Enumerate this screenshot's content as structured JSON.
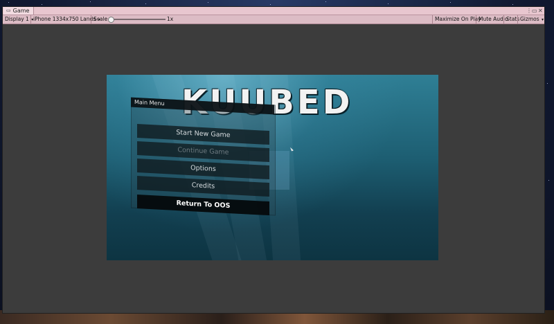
{
  "window": {
    "tab_label": "Game",
    "tab_icon": "gamepad-icon",
    "controls": [
      "⋮",
      "▭",
      "✕"
    ]
  },
  "toolbar": {
    "display": "Display 1",
    "resolution": "iPhone 1334x750 Lands",
    "scale_label": "Scale",
    "scale_value": "1x",
    "maximize": "Maximize On Play",
    "mute": "Mute Audio",
    "stats": "Stats",
    "gizmos": "Gizmos"
  },
  "game": {
    "logo": "KUUBED",
    "menu": {
      "title": "Main Menu",
      "items": [
        {
          "label": "Start New Game",
          "state": "normal"
        },
        {
          "label": "Continue Game",
          "state": "disabled"
        },
        {
          "label": "Options",
          "state": "normal"
        },
        {
          "label": "Credits",
          "state": "normal"
        },
        {
          "label": "Return To OOS",
          "state": "selected"
        }
      ]
    }
  },
  "colors": {
    "titlebar": "#e8c6cf",
    "toolbar": "#dcbcc5",
    "editor_bg": "#3c3c3c"
  }
}
